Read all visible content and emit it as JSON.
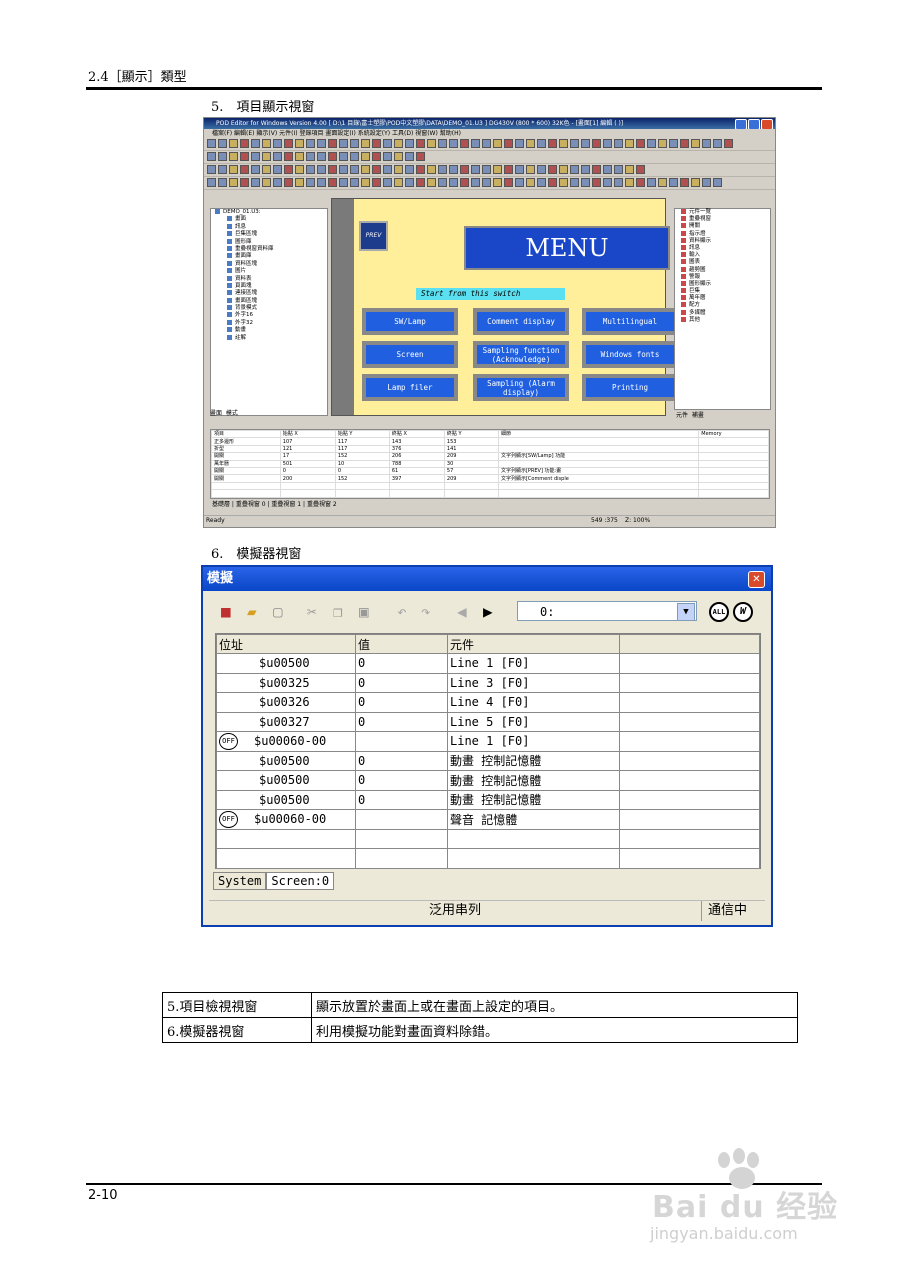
{
  "header": {
    "title": "2.4［顯示］類型"
  },
  "section5": {
    "title": "5.　項目顯示視窗"
  },
  "editor": {
    "title": "POD Editor for Windows Version 4.00 [ D:\\1 目錄\\富士塑膠\\POD中文塑膠\\DATA\\DEMO_01.U3 ] DG430V (800 * 600) 32K色 - [畫面[1] 編輯 (     )]",
    "menu": "檔案(F)  編輯(E)  顯示(V)  元件(I)  登錄項目  畫面設定(I)  系統設定(Y)  工具(D)  視窗(W)  幫助(H)",
    "tree": [
      "DEMO_01.U3:",
      "畫面",
      "訊息",
      "巨集區塊",
      "圖形庫",
      "重疊視窗資料庫",
      "畫面庫",
      "資料區塊",
      "圖片",
      "資料表",
      "頁面塊",
      "連接區塊",
      "畫面區塊",
      "背景模式",
      "外字16",
      "外字32",
      "動畫",
      "註解"
    ],
    "tree_tabs": [
      "畫面",
      "模式"
    ],
    "canvas": {
      "prev": "PREV",
      "menu_title": "MENU",
      "start": "Start from this switch",
      "buttons": [
        "SW/Lamp",
        "Comment display",
        "Multilingual",
        "Screen",
        "Sampling function (Acknowledge)",
        "Windows fonts",
        "Lamp filer",
        "Sampling (Alarm display)",
        "Printing"
      ]
    },
    "right_tree": [
      "元件一覽",
      "重疊視窗",
      "開關",
      "指示燈",
      "資料顯示",
      "訊息",
      "輸入",
      "圖表",
      "趨勢圖",
      "警報",
      "圖形顯示",
      "巨集",
      "萬年曆",
      "配方",
      "多媒體",
      "其他"
    ],
    "right_tabs": [
      "元件",
      "補畫"
    ],
    "grid_headers": [
      "項目",
      "始點 X",
      "始點 Y",
      "終點 X",
      "終點 Y",
      "細節",
      "Memory"
    ],
    "grid_rows": [
      [
        "正多邊形",
        "107",
        "117",
        "143",
        "153",
        "",
        ""
      ],
      [
        "折型",
        "121",
        "117",
        "376",
        "141",
        "",
        ""
      ],
      [
        "開關",
        "17",
        "152",
        "206",
        "209",
        "文字列顯示[SW/Lamp]  功能",
        ""
      ],
      [
        "萬年曆",
        "501",
        "10",
        "788",
        "30",
        "",
        ""
      ],
      [
        "開關",
        "0",
        "0",
        "61",
        "57",
        "文字列顯示[PREV]  功能:畫",
        ""
      ],
      [
        "開關",
        "200",
        "152",
        "397",
        "209",
        "文字列顯示[Comment disple",
        ""
      ]
    ],
    "grid_tabs": "基礎層 | 重疊視窗 0 | 重疊視窗 1 | 重疊視窗 2",
    "status_left": "Ready",
    "status_coord": "549 :375",
    "status_zoom": "Z: 100%"
  },
  "section6": {
    "title": "6.　模擬器視窗"
  },
  "simulator": {
    "title": "模擬",
    "address": "0:",
    "columns": [
      "位址",
      "值",
      "元件",
      ""
    ],
    "rows": [
      {
        "off": "",
        "addr": "$u00500",
        "val": "0",
        "item": "Line 1 [F0]"
      },
      {
        "off": "",
        "addr": "$u00325",
        "val": "0",
        "item": "Line 3 [F0]"
      },
      {
        "off": "",
        "addr": "$u00326",
        "val": "0",
        "item": "Line 4 [F0]"
      },
      {
        "off": "",
        "addr": "$u00327",
        "val": "0",
        "item": "Line 5 [F0]"
      },
      {
        "off": "OFF",
        "addr": "$u00060-00",
        "val": "",
        "item": "Line 1 [F0]"
      },
      {
        "off": "",
        "addr": "$u00500",
        "val": "0",
        "item": "動畫 控制記憶體"
      },
      {
        "off": "",
        "addr": "$u00500",
        "val": "0",
        "item": "動畫 控制記憶體"
      },
      {
        "off": "",
        "addr": "$u00500",
        "val": "0",
        "item": "動畫 控制記憶體"
      },
      {
        "off": "OFF",
        "addr": "$u00060-00",
        "val": "",
        "item": "聲音 記憶體"
      }
    ],
    "tabs": [
      "System",
      "Screen:0"
    ],
    "status_center": "泛用串列",
    "status_right": "通信中",
    "all_label": "ALL",
    "w_label": "W"
  },
  "description": [
    {
      "label": "5.項目檢視視窗",
      "text": "顯示放置於畫面上或在畫面上設定的項目。"
    },
    {
      "label": "6.模擬器視窗",
      "text": "利用模擬功能對畫面資料除錯。"
    }
  ],
  "footer": {
    "page": "2-10"
  },
  "watermark": {
    "text": "Bai du 经验",
    "url": "jingyan.baidu.com"
  }
}
